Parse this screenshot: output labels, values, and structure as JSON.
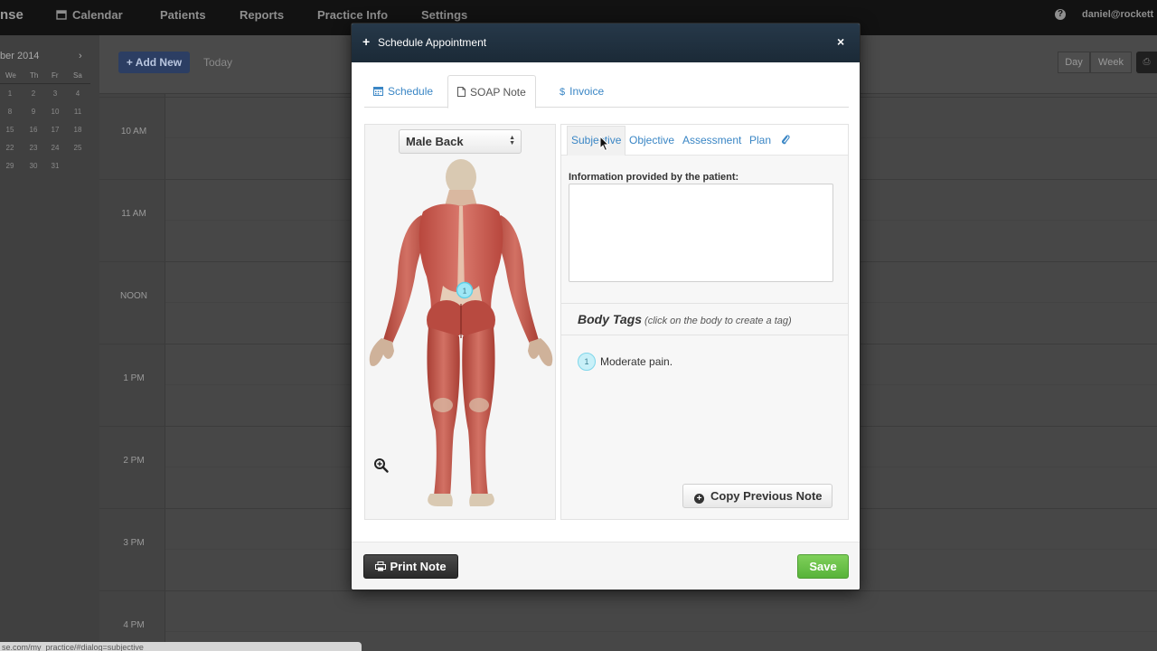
{
  "background": {
    "brand": "nse",
    "nav": [
      "Calendar",
      "Patients",
      "Reports",
      "Practice Info",
      "Settings"
    ],
    "user": "daniel@rockett",
    "help": "?",
    "mini_calendar": {
      "title": "ber 2014",
      "next": "›",
      "weekdays": [
        "We",
        "Th",
        "Fr",
        "Sa"
      ],
      "weeks": [
        [
          "1",
          "2",
          "3",
          "4"
        ],
        [
          "8",
          "9",
          "10",
          "11"
        ],
        [
          "15",
          "16",
          "17",
          "18"
        ],
        [
          "22",
          "23",
          "24",
          "25"
        ],
        [
          "29",
          "30",
          "31",
          ""
        ]
      ]
    },
    "toolbar": {
      "add_new": "+ Add New",
      "today": "Today",
      "day": "Day",
      "week": "Week",
      "print": "⎙"
    },
    "hours": [
      "10 AM",
      "11 AM",
      "NOON",
      "1 PM",
      "2 PM",
      "3 PM",
      "4 PM"
    ],
    "status_url": "se.com/my_practice/#dialog=subjective"
  },
  "modal": {
    "title": "Schedule Appointment",
    "close": "×",
    "tabs": [
      {
        "label": "Schedule",
        "icon": "calendar-icon"
      },
      {
        "label": "SOAP Note",
        "icon": "document-icon"
      },
      {
        "label": "Invoice",
        "icon": "dollar-icon"
      }
    ],
    "body_select": "Male Back",
    "soap_tabs": [
      "Subjective",
      "Objective",
      "Assessment",
      "Plan"
    ],
    "subjective_label": "Information provided by the patient:",
    "subjective_value": "",
    "body_tags_title": "Body Tags",
    "body_tags_hint": "(click on the body to create a tag)",
    "tags": [
      {
        "number": "1",
        "text": "Moderate pain."
      }
    ],
    "marker_number": "1",
    "copy_button": "Copy Previous Note",
    "print_button": "Print Note",
    "save_button": "Save"
  },
  "colors": {
    "header": "#1f2f3d",
    "link": "#3a86c5",
    "save": "#6cc24a",
    "print": "#333333",
    "tag": "#c8f0f8"
  }
}
